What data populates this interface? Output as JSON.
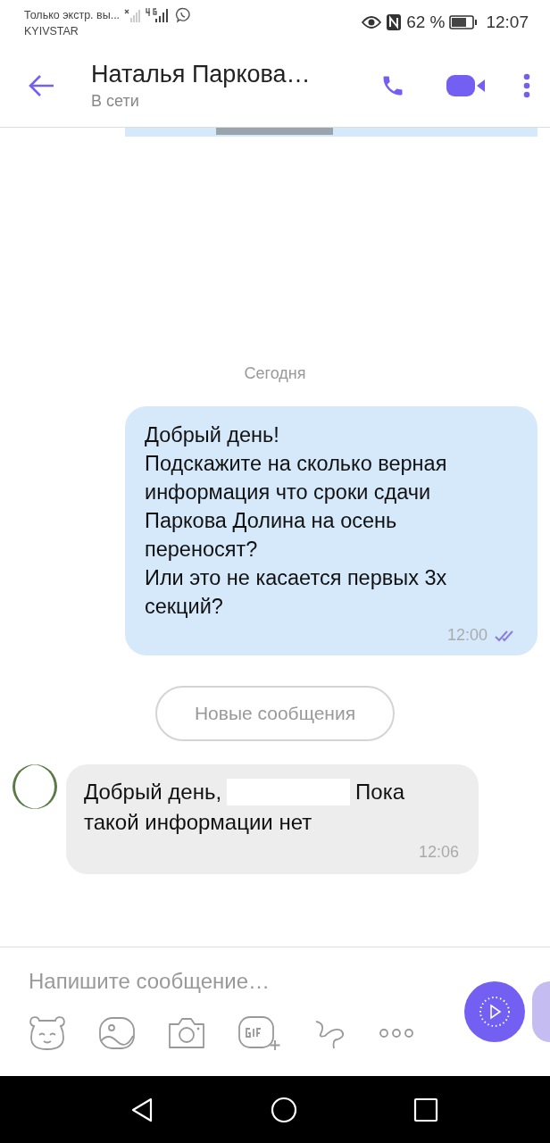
{
  "status_bar": {
    "notification": "Только экстр. вы...",
    "carrier": "KYIVSTAR",
    "battery_percent": "62 %",
    "time": "12:07"
  },
  "header": {
    "contact_name": "Наталья Паркова…",
    "presence": "В сети"
  },
  "date_separator": "Сегодня",
  "messages": [
    {
      "kind": "outgoing",
      "text": "Добрый день!\nПодскажите на сколько верная\nинформация что сроки сдачи\nПаркова Долина на осень\nпереносят?\nИли это не касается первых 3х\nсекций?",
      "time": "12:00",
      "read": true
    },
    {
      "kind": "new_marker",
      "text": "Новые сообщения"
    },
    {
      "kind": "incoming",
      "segments": [
        {
          "kind": "text",
          "text": "Добрый день,"
        },
        {
          "kind": "redacted"
        },
        {
          "kind": "text",
          "text": "Пока"
        },
        {
          "kind": "break"
        },
        {
          "kind": "text",
          "text": "такой информации нет"
        }
      ],
      "time": "12:06"
    }
  ],
  "composer": {
    "placeholder": "Напишите сообщение…"
  }
}
